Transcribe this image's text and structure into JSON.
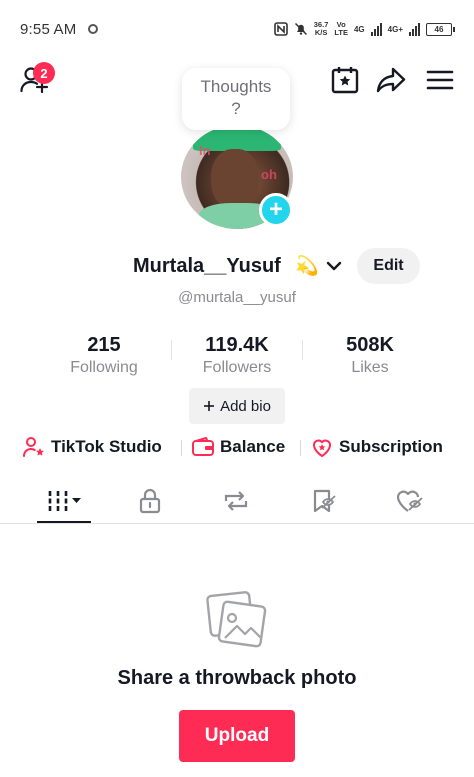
{
  "status_bar": {
    "time": "9:55 AM",
    "speed_value": "36.7",
    "speed_unit": "K/S",
    "volte_top": "Vo",
    "volte_bottom": "LTE",
    "net1": "4G",
    "net2": "4G+",
    "battery": "46"
  },
  "top_nav": {
    "friend_requests_count": "2",
    "thoughts_title": "Thoughts",
    "thoughts_placeholder": "?",
    "icons": [
      "add-friends-icon",
      "calendar-star-icon",
      "share-icon",
      "menu-icon"
    ]
  },
  "profile": {
    "username": "Murtala__Yusuf",
    "emoji": "💫",
    "handle": "@murtala__yusuf",
    "edit_label": "Edit",
    "add_bio_label": "Add bio",
    "avatar_overlay_text_1": "In",
    "avatar_overlay_text_2": "oh"
  },
  "stats": [
    {
      "value": "215",
      "label": "Following"
    },
    {
      "value": "119.4K",
      "label": "Followers"
    },
    {
      "value": "508K",
      "label": "Likes"
    }
  ],
  "tools": [
    {
      "label": "TikTok Studio",
      "icon": "tiktok-studio-icon"
    },
    {
      "label": "Balance",
      "icon": "wallet-icon"
    },
    {
      "label": "Subscription",
      "icon": "subscription-icon"
    }
  ],
  "tabs": {
    "icons": [
      "videos-grid-icon",
      "private-lock-icon",
      "reposts-icon",
      "favorites-icon",
      "liked-icon"
    ],
    "selected": 0
  },
  "empty_state": {
    "title": "Share a throwback photo",
    "upload_label": "Upload",
    "icon": "photo-icon"
  },
  "colors": {
    "accent": "#fe2c55",
    "avatar_plus": "#20d5ec",
    "secondary_text": "#8a8b91"
  }
}
